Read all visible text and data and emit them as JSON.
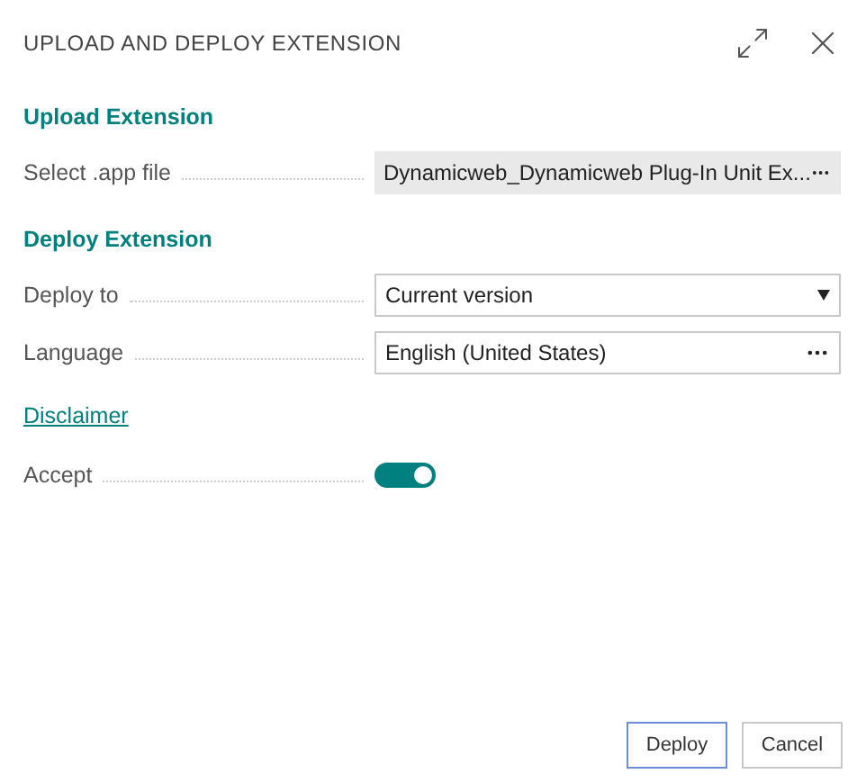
{
  "window": {
    "title": "UPLOAD AND DEPLOY EXTENSION"
  },
  "sections": [
    {
      "title": "Upload Extension",
      "fields": [
        {
          "kind": "file",
          "label": "Select .app file",
          "value": "Dynamicweb_Dynamicweb Plug-In Unit Ex..."
        }
      ]
    },
    {
      "title": "Deploy Extension",
      "fields": [
        {
          "kind": "select",
          "label": "Deploy to",
          "value": "Current version"
        },
        {
          "kind": "lookup",
          "label": "Language",
          "value": "English (United States)"
        },
        {
          "kind": "link",
          "label": "Disclaimer"
        },
        {
          "kind": "toggle",
          "label": "Accept",
          "on": true
        }
      ]
    }
  ],
  "buttons": [
    {
      "label": "Deploy",
      "selected": true
    },
    {
      "label": "Cancel",
      "selected": false
    }
  ]
}
